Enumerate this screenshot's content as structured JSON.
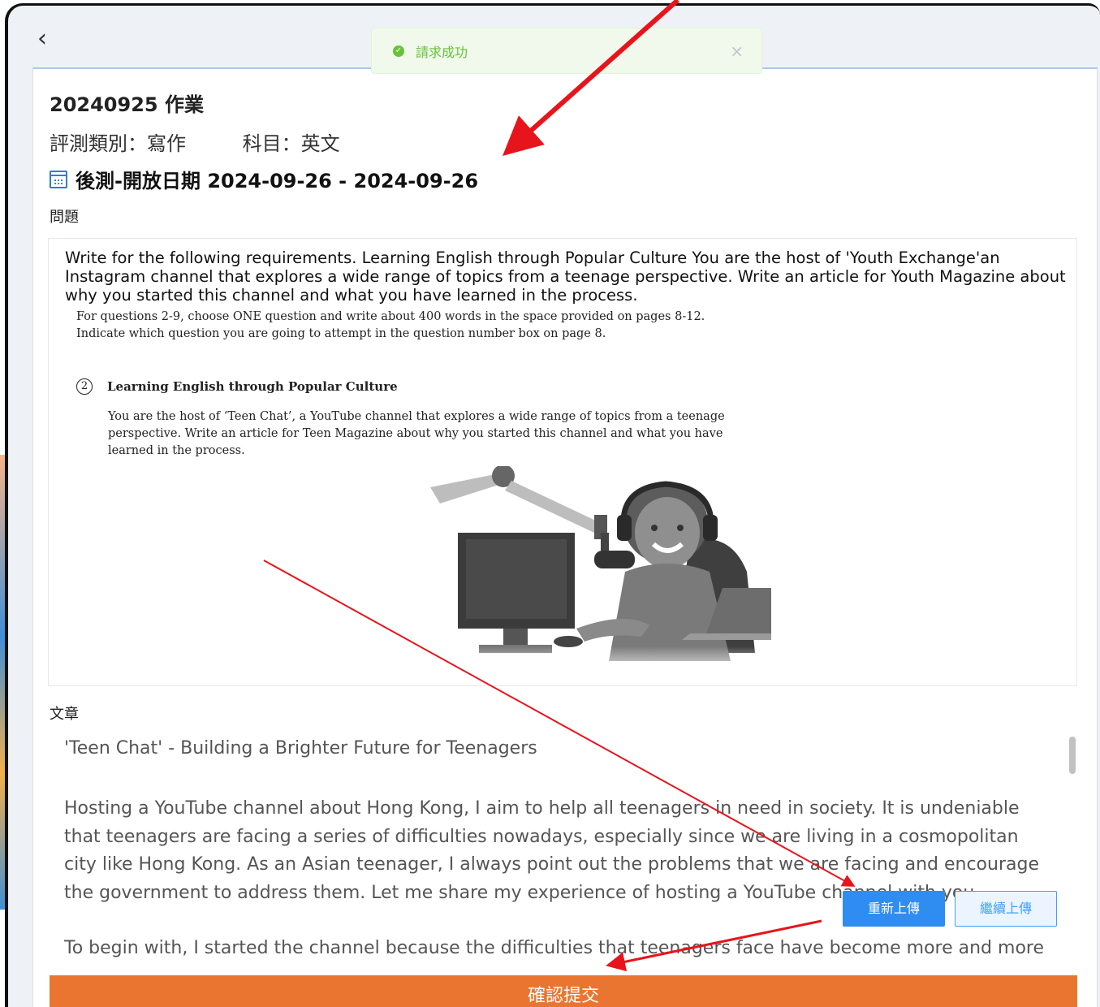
{
  "toast": {
    "message": "請求成功",
    "close": "×"
  },
  "nav": {
    "back": "‹"
  },
  "header": {
    "title": "20240925 作業",
    "category": "評測類別：寫作",
    "subject": "科目：英文",
    "date_range": "後測-開放日期 2024-09-26 - 2024-09-26"
  },
  "question": {
    "label": "問題",
    "text": "Write for the following requirements. Learning English through Popular Culture You are the host of 'Youth Exchange'an Instagram channel that explores a wide range of topics from a teenage perspective. Write an article for Youth Magazine about why you started this channel and what you have learned in the process.",
    "instructions_line1": "For questions 2-9, choose ONE question and write about 400 words in the space provided on pages 8-12.",
    "instructions_line2": "Indicate which question you are going to attempt in the question number box on page 8.",
    "item_number": "2",
    "item_title": "Learning English through Popular Culture",
    "item_body": "You are the host of ‘Teen Chat’, a YouTube channel that explores a wide range of topics from a teenage perspective. Write an article for Teen Magazine about why you started this channel and what you have learned in the process."
  },
  "essay": {
    "label": "文章",
    "title": "'Teen Chat' - Building a Brighter Future for Teenagers",
    "para1": "Hosting a YouTube channel about Hong Kong, I aim to help all teenagers in need in society. It is undeniable that teenagers are facing a series of difficulties nowadays, especially since we are living in a cosmopolitan city like Hong Kong. As an Asian teenager, I always point out the problems that we are facing and encourage the government to address them. Let me share my experience of hosting a YouTube channel with you.",
    "para2": "To begin with, I started the channel because the difficulties that teenagers face have become more and more"
  },
  "buttons": {
    "reupload": "重新上傳",
    "continue_upload": "繼續上傳",
    "submit": "確認提交"
  },
  "colors": {
    "submit": "#ea7530",
    "primary": "#2f8cf0",
    "success": "#67c23a",
    "annotation": "#e8141b"
  }
}
